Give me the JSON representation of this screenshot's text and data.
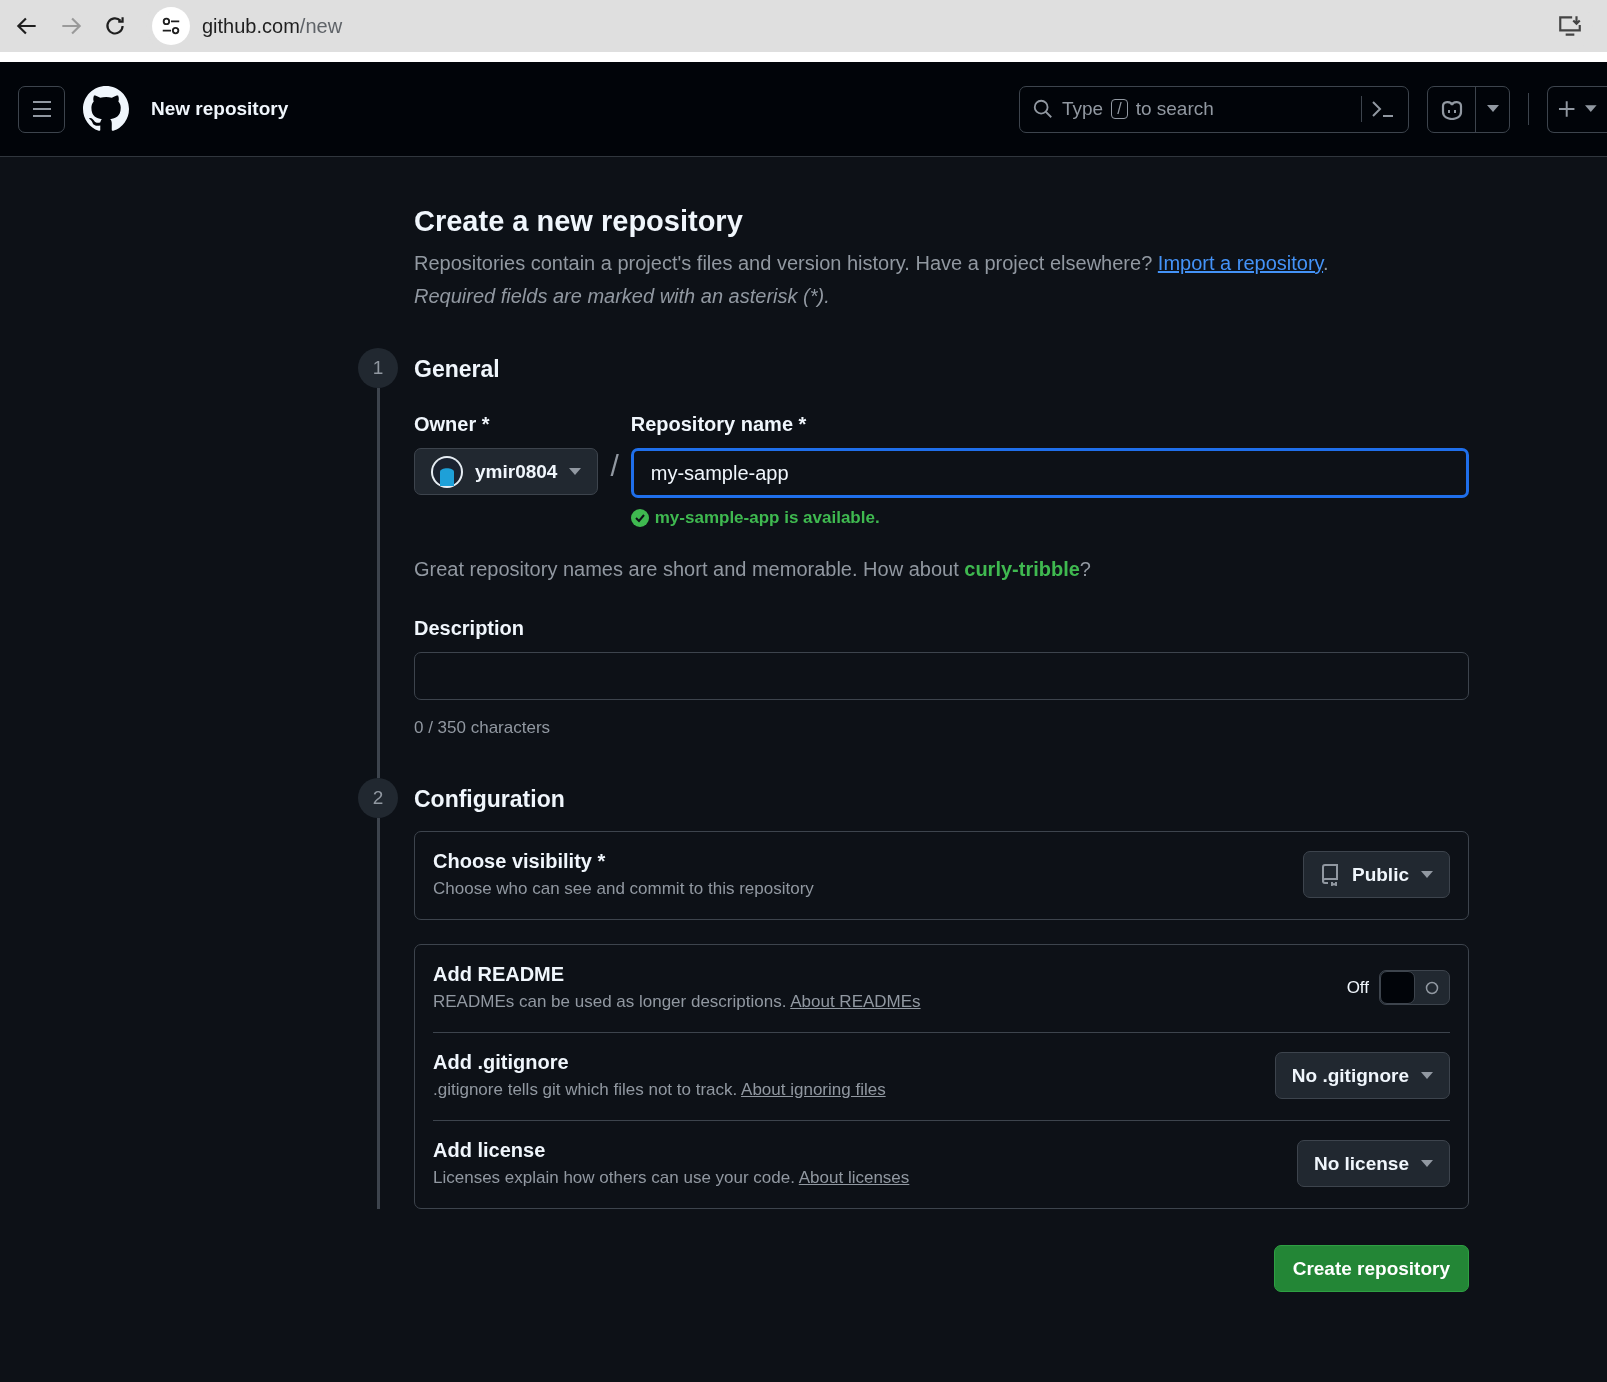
{
  "browser": {
    "url_host": "github.com",
    "url_path": "/new"
  },
  "header": {
    "title": "New repository",
    "search": {
      "before": "Type",
      "key": "/",
      "after": "to search"
    }
  },
  "page": {
    "title": "Create a new repository",
    "intro": "Repositories contain a project's files and version history. Have a project elsewhere?",
    "import_link": "Import a repository",
    "intro_end": ".",
    "required_note": "Required fields are marked with an asterisk (*)."
  },
  "general": {
    "number": "1",
    "title": "General",
    "owner": {
      "label": "Owner *",
      "value": "ymir0804"
    },
    "separator": "/",
    "repository_name": {
      "label": "Repository name *",
      "value": "my-sample-app",
      "availability": "my-sample-app is available."
    },
    "suggestion": {
      "before": "Great repository names are short and memorable. How about",
      "name": "curly-tribble",
      "after": "?"
    },
    "description": {
      "label": "Description",
      "counter": "0 / 350 characters"
    }
  },
  "configuration": {
    "number": "2",
    "title": "Configuration",
    "visibility": {
      "title": "Choose visibility *",
      "hint": "Choose who can see and commit to this repository",
      "value": "Public"
    },
    "options": [
      {
        "kind": "toggle",
        "title": "Add README",
        "hint": "READMEs can be used as longer descriptions.",
        "link": "About READMEs",
        "on": false,
        "state_label": "Off"
      },
      {
        "kind": "select",
        "title": "Add .gitignore",
        "hint": ".gitignore tells git which files not to track.",
        "link": "About ignoring files",
        "value": "No .gitignore"
      },
      {
        "kind": "select",
        "title": "Add license",
        "hint": "Licenses explain how others can use your code.",
        "link": "About licenses",
        "value": "No license"
      }
    ]
  },
  "submit": "Create repository"
}
